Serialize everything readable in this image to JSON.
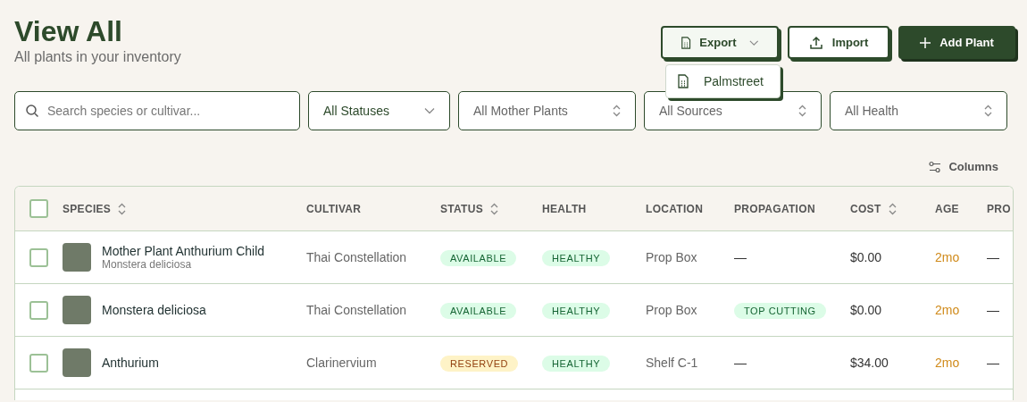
{
  "header": {
    "title": "View All",
    "subtitle": "All plants in your inventory"
  },
  "actions": [
    {
      "kind": "export",
      "label": "Export",
      "expanded": true,
      "menu": [
        {
          "label": "Palmstreet"
        }
      ]
    },
    {
      "kind": "import",
      "label": "Import"
    },
    {
      "kind": "add",
      "label": "Add Plant"
    }
  ],
  "filters": [
    {
      "kind": "search",
      "placeholder": "Search species or cultivar..."
    },
    {
      "kind": "select",
      "value": "All Statuses"
    },
    {
      "kind": "combo",
      "value": "All Mother Plants"
    },
    {
      "kind": "combo",
      "value": "All Sources"
    },
    {
      "kind": "combo",
      "value": "All Health"
    }
  ],
  "columns_button": {
    "label": "Columns"
  },
  "table": {
    "select_all": {
      "checked": false
    },
    "columns": [
      {
        "label": "SPECIES",
        "sortable": true
      },
      {
        "label": "CULTIVAR",
        "sortable": false
      },
      {
        "label": "STATUS",
        "sortable": true
      },
      {
        "label": "HEALTH",
        "sortable": false
      },
      {
        "label": "LOCATION",
        "sortable": false
      },
      {
        "label": "PROPAGATION",
        "sortable": false
      },
      {
        "label": "COST",
        "sortable": true
      },
      {
        "label": "AGE",
        "sortable": false
      },
      {
        "label": "PRO"
      }
    ],
    "rows": [
      {
        "checked": false,
        "name": "Mother Plant Anthurium Child",
        "subname": "Monstera deliciosa",
        "cultivar": "Thai Constellation",
        "status": {
          "label": "AVAILABLE",
          "kind": "available"
        },
        "health": {
          "label": "HEALTHY",
          "kind": "healthy"
        },
        "location": "Prop Box",
        "propagation": {
          "label": "—",
          "kind": "none"
        },
        "cost": "$0.00",
        "age": "2mo",
        "column_9": "—"
      },
      {
        "checked": false,
        "name": "Monstera deliciosa",
        "cultivar": "Thai Constellation",
        "status": {
          "label": "AVAILABLE",
          "kind": "available"
        },
        "health": {
          "label": "HEALTHY",
          "kind": "healthy"
        },
        "location": "Prop Box",
        "propagation": {
          "label": "TOP CUTTING",
          "kind": "tag"
        },
        "cost": "$0.00",
        "age": "2mo",
        "column_9": "—"
      },
      {
        "checked": false,
        "name": "Anthurium",
        "cultivar": "Clarinervium",
        "status": {
          "label": "RESERVED",
          "kind": "reserved"
        },
        "health": {
          "label": "HEALTHY",
          "kind": "healthy"
        },
        "location": "Shelf C-1",
        "propagation": {
          "label": "—",
          "kind": "none"
        },
        "cost": "$34.00",
        "age": "2mo",
        "column_9": "—"
      }
    ]
  }
}
